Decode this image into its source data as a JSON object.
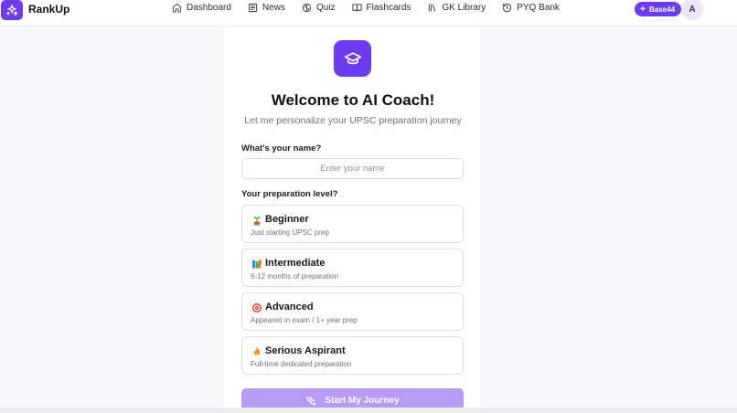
{
  "header": {
    "brand": "RankUp",
    "nav": [
      {
        "label": "Dashboard",
        "icon": "home-icon"
      },
      {
        "label": "News",
        "icon": "newspaper-icon"
      },
      {
        "label": "Quiz",
        "icon": "brain-icon"
      },
      {
        "label": "Flashcards",
        "icon": "book-icon"
      },
      {
        "label": "GK Library",
        "icon": "library-icon"
      },
      {
        "label": "PYQ Bank",
        "icon": "history-icon"
      }
    ],
    "badge": "Base44",
    "avatar_initial": "A"
  },
  "onboarding": {
    "title": "Welcome to AI Coach!",
    "subtitle": "Let me personalize your UPSC preparation journey",
    "name_label": "What's your name?",
    "name_placeholder": "Enter your name",
    "name_value": "",
    "level_label": "Your preparation level?",
    "levels": [
      {
        "title": "Beginner",
        "desc": "Just starting UPSC prep",
        "icon": "seedling-icon"
      },
      {
        "title": "Intermediate",
        "desc": "6-12 months of preparation",
        "icon": "books-icon"
      },
      {
        "title": "Advanced",
        "desc": "Appeared in exam / 1+ year prep",
        "icon": "target-icon"
      },
      {
        "title": "Serious Aspirant",
        "desc": "Full-time dedicated preparation",
        "icon": "fire-icon"
      }
    ],
    "start_label": "Start My Journey"
  },
  "colors": {
    "brand": "#6d3cf0",
    "button_disabled": "#b79cf6"
  }
}
